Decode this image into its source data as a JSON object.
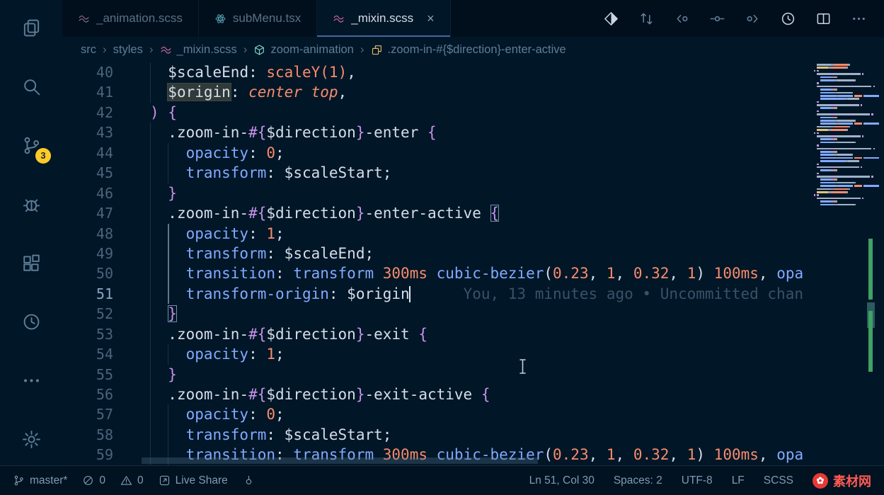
{
  "colors": {
    "background": "#011627",
    "accent_blue": "#82aaff",
    "accent_orange": "#f78c6c",
    "accent_pink": "#c792ea",
    "badge_yellow": "#ffca28",
    "change_green": "#3fa263",
    "watermark_red": "#e53935"
  },
  "activity_bar": {
    "items": [
      {
        "id": "explorer",
        "icon": "files-icon"
      },
      {
        "id": "search",
        "icon": "search-icon"
      },
      {
        "id": "source-control",
        "icon": "source-control-icon",
        "badge": "3"
      },
      {
        "id": "run-and-debug",
        "icon": "debug-icon"
      },
      {
        "id": "extensions",
        "icon": "extensions-icon"
      },
      {
        "id": "timeline",
        "icon": "history-icon"
      },
      {
        "id": "additional-views",
        "icon": "more-icon"
      },
      {
        "id": "manage",
        "icon": "gear-icon",
        "bottom": true
      }
    ]
  },
  "tabs": {
    "close_glyph": "×",
    "items": [
      {
        "label": "_animation.scss",
        "icon": "sass-icon",
        "active": false
      },
      {
        "label": "subMenu.tsx",
        "icon": "react-icon",
        "active": false
      },
      {
        "label": "_mixin.scss",
        "icon": "sass-icon",
        "active": true,
        "close": true
      }
    ]
  },
  "editor_actions": [
    {
      "icon": "open-changes-icon",
      "bright": true
    },
    {
      "icon": "compare-changes-icon",
      "bright": false
    },
    {
      "icon": "previous-change-icon",
      "bright": false
    },
    {
      "icon": "blame-annotations-icon",
      "bright": false
    },
    {
      "icon": "next-change-icon",
      "bright": false
    },
    {
      "icon": "file-history-icon",
      "bright": true
    },
    {
      "icon": "split-editor-icon",
      "bright": true
    },
    {
      "icon": "more-actions-icon",
      "bright": false
    }
  ],
  "breadcrumb": {
    "chevron": "›",
    "segments": [
      {
        "label": "src"
      },
      {
        "label": "styles"
      },
      {
        "label": "_mixin.scss",
        "icon": "sass-icon"
      },
      {
        "label": "zoom-animation",
        "icon": "symbol-cube-icon"
      },
      {
        "label": ".zoom-in-#{$direction}-enter-active",
        "icon": "symbol-class-icon"
      }
    ]
  },
  "editor": {
    "active_line": 51,
    "blame_text": "You, 13 minutes ago • Uncommitted chan",
    "lines": [
      {
        "n": 40,
        "gl": 1,
        "t": [
          [
            "d",
            "  "
          ],
          [
            "v",
            "$scaleEnd"
          ],
          [
            "d",
            ": "
          ],
          [
            "o",
            "scaleY("
          ],
          [
            "n",
            "1"
          ],
          [
            "o",
            ")"
          ],
          [
            "d",
            ","
          ]
        ]
      },
      {
        "n": 41,
        "gl": 1,
        "t": [
          [
            "d",
            "  "
          ],
          [
            "hl",
            "$origin"
          ],
          [
            "d",
            ": "
          ],
          [
            "i",
            "center top"
          ],
          [
            "d",
            ","
          ]
        ]
      },
      {
        "n": 42,
        "gl": 0,
        "t": [
          [
            "b",
            ")"
          ],
          [
            "d",
            " "
          ],
          [
            "b",
            "{"
          ]
        ]
      },
      {
        "n": 43,
        "gl": 1,
        "t": [
          [
            "d",
            "  "
          ],
          [
            "s",
            ".zoom-in-"
          ],
          [
            "b",
            "#{"
          ],
          [
            "v",
            "$direction"
          ],
          [
            "b",
            "}"
          ],
          [
            "s",
            "-enter"
          ],
          [
            "d",
            " "
          ],
          [
            "b",
            "{"
          ]
        ]
      },
      {
        "n": 44,
        "gl": 2,
        "t": [
          [
            "d",
            "    "
          ],
          [
            "p",
            "opacity"
          ],
          [
            "d",
            ": "
          ],
          [
            "n",
            "0"
          ],
          [
            "d",
            ";"
          ]
        ]
      },
      {
        "n": 45,
        "gl": 2,
        "t": [
          [
            "d",
            "    "
          ],
          [
            "p",
            "transform"
          ],
          [
            "d",
            ": "
          ],
          [
            "v",
            "$scaleStart"
          ],
          [
            "d",
            ";"
          ]
        ]
      },
      {
        "n": 46,
        "gl": 1,
        "t": [
          [
            "d",
            "  "
          ],
          [
            "b",
            "}"
          ]
        ]
      },
      {
        "n": 47,
        "gl": 1,
        "t": [
          [
            "d",
            "  "
          ],
          [
            "s",
            ".zoom-in-"
          ],
          [
            "b",
            "#{"
          ],
          [
            "v",
            "$direction"
          ],
          [
            "b",
            "}"
          ],
          [
            "s",
            "-enter-active"
          ],
          [
            "d",
            " "
          ],
          [
            "bm",
            "{"
          ]
        ]
      },
      {
        "n": 48,
        "gl": 2,
        "ag": true,
        "t": [
          [
            "d",
            "    "
          ],
          [
            "p",
            "opacity"
          ],
          [
            "d",
            ": "
          ],
          [
            "n",
            "1"
          ],
          [
            "d",
            ";"
          ]
        ]
      },
      {
        "n": 49,
        "gl": 2,
        "ag": true,
        "t": [
          [
            "d",
            "    "
          ],
          [
            "p",
            "transform"
          ],
          [
            "d",
            ": "
          ],
          [
            "v",
            "$scaleEnd"
          ],
          [
            "d",
            ";"
          ]
        ]
      },
      {
        "n": 50,
        "gl": 2,
        "ag": true,
        "t": [
          [
            "d",
            "    "
          ],
          [
            "p",
            "transition"
          ],
          [
            "d",
            ": "
          ],
          [
            "p",
            "transform"
          ],
          [
            "d",
            " "
          ],
          [
            "n",
            "300ms"
          ],
          [
            "d",
            " "
          ],
          [
            "p",
            "cubic-bezier"
          ],
          [
            "d",
            "("
          ],
          [
            "n",
            "0.23"
          ],
          [
            "d",
            ", "
          ],
          [
            "n",
            "1"
          ],
          [
            "d",
            ", "
          ],
          [
            "n",
            "0.32"
          ],
          [
            "d",
            ", "
          ],
          [
            "n",
            "1"
          ],
          [
            "d",
            ") "
          ],
          [
            "n",
            "100ms"
          ],
          [
            "d",
            ", "
          ],
          [
            "p",
            "opa"
          ]
        ]
      },
      {
        "n": 51,
        "gl": 2,
        "ag": true,
        "t": [
          [
            "d",
            "    "
          ],
          [
            "p",
            "transform-origin"
          ],
          [
            "d",
            ": "
          ],
          [
            "v",
            "$origin"
          ],
          [
            "caret",
            ""
          ],
          [
            "g",
            "      You, 13 minutes ago • Uncommitted chan"
          ]
        ]
      },
      {
        "n": 52,
        "gl": 1,
        "t": [
          [
            "d",
            "  "
          ],
          [
            "bm",
            "}"
          ]
        ]
      },
      {
        "n": 53,
        "gl": 1,
        "t": [
          [
            "d",
            "  "
          ],
          [
            "s",
            ".zoom-in-"
          ],
          [
            "b",
            "#{"
          ],
          [
            "v",
            "$direction"
          ],
          [
            "b",
            "}"
          ],
          [
            "s",
            "-exit"
          ],
          [
            "d",
            " "
          ],
          [
            "b",
            "{"
          ]
        ]
      },
      {
        "n": 54,
        "gl": 2,
        "t": [
          [
            "d",
            "    "
          ],
          [
            "p",
            "opacity"
          ],
          [
            "d",
            ": "
          ],
          [
            "n",
            "1"
          ],
          [
            "d",
            ";"
          ]
        ]
      },
      {
        "n": 55,
        "gl": 1,
        "t": [
          [
            "d",
            "  "
          ],
          [
            "b",
            "}"
          ]
        ]
      },
      {
        "n": 56,
        "gl": 1,
        "t": [
          [
            "d",
            "  "
          ],
          [
            "s",
            ".zoom-in-"
          ],
          [
            "b",
            "#{"
          ],
          [
            "v",
            "$direction"
          ],
          [
            "b",
            "}"
          ],
          [
            "s",
            "-exit-active"
          ],
          [
            "d",
            " "
          ],
          [
            "b",
            "{"
          ]
        ]
      },
      {
        "n": 57,
        "gl": 2,
        "t": [
          [
            "d",
            "    "
          ],
          [
            "p",
            "opacity"
          ],
          [
            "d",
            ": "
          ],
          [
            "n",
            "0"
          ],
          [
            "d",
            ";"
          ]
        ]
      },
      {
        "n": 58,
        "gl": 2,
        "t": [
          [
            "d",
            "    "
          ],
          [
            "p",
            "transform"
          ],
          [
            "d",
            ": "
          ],
          [
            "v",
            "$scaleStart"
          ],
          [
            "d",
            ";"
          ]
        ]
      },
      {
        "n": 59,
        "gl": 2,
        "t": [
          [
            "d",
            "    "
          ],
          [
            "p",
            "transition"
          ],
          [
            "d",
            ": "
          ],
          [
            "p",
            "transform"
          ],
          [
            "d",
            " "
          ],
          [
            "n",
            "300ms"
          ],
          [
            "d",
            " "
          ],
          [
            "p",
            "cubic-bezier"
          ],
          [
            "d",
            "("
          ],
          [
            "n",
            "0.23"
          ],
          [
            "d",
            ", "
          ],
          [
            "n",
            "1"
          ],
          [
            "d",
            ", "
          ],
          [
            "n",
            "0.32"
          ],
          [
            "d",
            ", "
          ],
          [
            "n",
            "1"
          ],
          [
            "d",
            ") "
          ],
          [
            "n",
            "100ms"
          ],
          [
            "d",
            ", "
          ],
          [
            "p",
            "opa"
          ]
        ]
      }
    ]
  },
  "status_bar": {
    "left": [
      {
        "id": "branch",
        "icon": "git-branch-icon",
        "label": "master*"
      },
      {
        "id": "errors",
        "icon": "error-icon",
        "label": "0"
      },
      {
        "id": "warnings",
        "icon": "warning-icon",
        "label": "0"
      },
      {
        "id": "live-share",
        "icon": "live-share-icon",
        "label": "Live Share"
      },
      {
        "id": "broadcast",
        "icon": "broadcast-icon",
        "label": ""
      }
    ],
    "right": [
      {
        "id": "cursor-position",
        "label": "Ln 51, Col 30"
      },
      {
        "id": "indentation",
        "label": "Spaces: 2"
      },
      {
        "id": "encoding",
        "label": "UTF-8"
      },
      {
        "id": "eol",
        "label": "LF"
      },
      {
        "id": "language-mode",
        "label": "SCSS"
      },
      {
        "id": "watermark",
        "icon": "watermark-logo",
        "label": "素材网",
        "logo_glyph": "✿"
      }
    ]
  }
}
